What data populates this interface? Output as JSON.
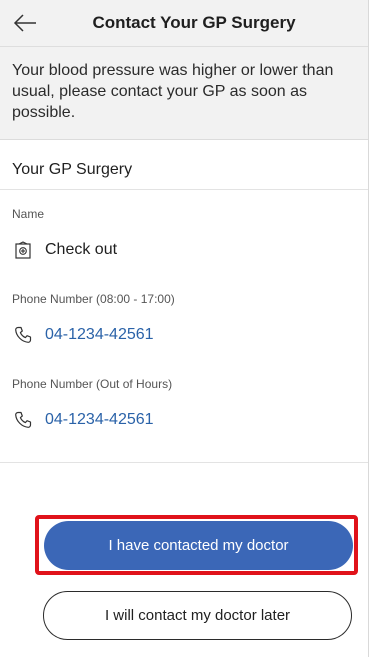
{
  "header": {
    "title": "Contact Your GP Surgery",
    "back_icon": "arrow-left-icon"
  },
  "alert": {
    "message": "Your blood pressure was higher or lower than usual, please contact your GP as soon as possible."
  },
  "surgery": {
    "section_title": "Your GP Surgery",
    "name_label": "Name",
    "name_value": "Check out",
    "name_icon": "clinic-icon",
    "phone_day_label": "Phone Number (08:00 - 17:00)",
    "phone_day_value": "04-1234-42561",
    "phone_ooh_label": "Phone Number (Out of Hours)",
    "phone_ooh_value": "04-1234-42561",
    "phone_icon": "phone-icon"
  },
  "actions": {
    "contacted_label": "I have contacted my doctor",
    "later_label": "I will contact my doctor later"
  },
  "colors": {
    "primary": "#3b67b7",
    "link": "#2a62a8",
    "highlight": "#e0121a",
    "panel": "#f2f2f2"
  }
}
